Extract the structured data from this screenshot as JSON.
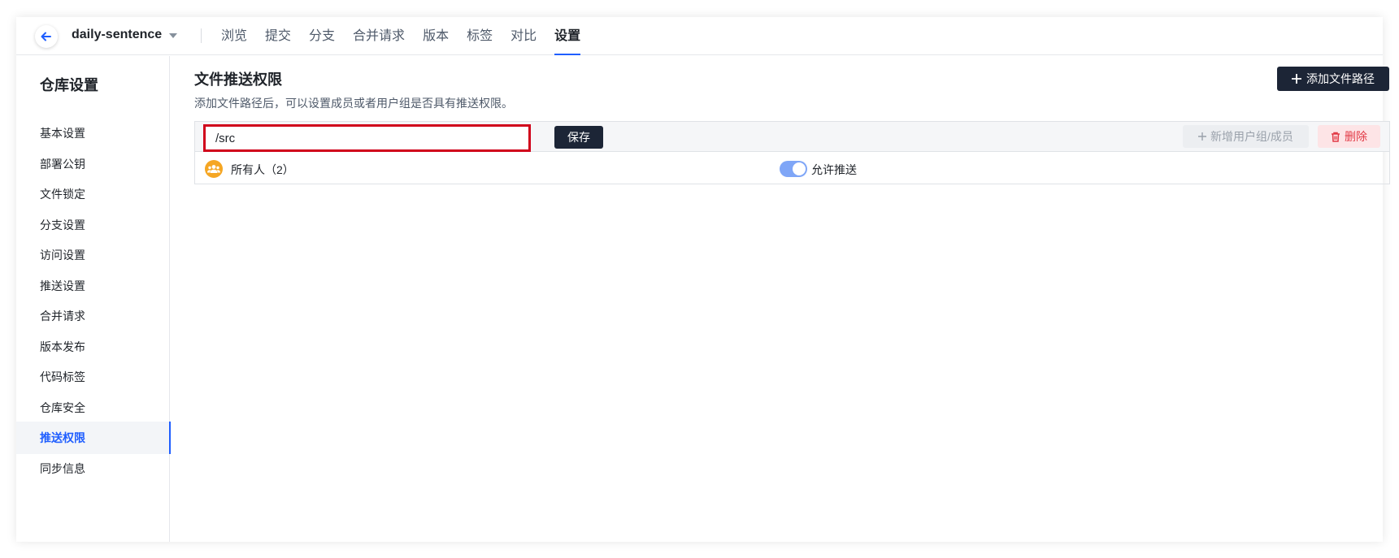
{
  "header": {
    "repo_name": "daily-sentence",
    "tabs": [
      {
        "label": "浏览"
      },
      {
        "label": "提交"
      },
      {
        "label": "分支"
      },
      {
        "label": "合并请求"
      },
      {
        "label": "版本"
      },
      {
        "label": "标签"
      },
      {
        "label": "对比"
      },
      {
        "label": "设置",
        "active": true
      }
    ]
  },
  "sidebar": {
    "title": "仓库设置",
    "items": [
      {
        "label": "基本设置"
      },
      {
        "label": "部署公钥"
      },
      {
        "label": "文件锁定"
      },
      {
        "label": "分支设置"
      },
      {
        "label": "访问设置"
      },
      {
        "label": "推送设置"
      },
      {
        "label": "合并请求"
      },
      {
        "label": "版本发布"
      },
      {
        "label": "代码标签"
      },
      {
        "label": "仓库安全"
      },
      {
        "label": "推送权限",
        "active": true
      },
      {
        "label": "同步信息"
      }
    ]
  },
  "main": {
    "title": "文件推送权限",
    "description": "添加文件路径后，可以设置成员或者用户组是否具有推送权限。",
    "add_path_label": "添加文件路径",
    "rule": {
      "path_value": "/src",
      "save_label": "保存",
      "add_member_label": "新增用户组/成员",
      "delete_label": "删除",
      "group_name": "所有人（2）",
      "allow_push_label": "允许推送",
      "allow_push_on": true
    }
  },
  "colors": {
    "accent": "#1f5eff",
    "dark_button": "#1c2536",
    "highlight_border": "#d0021b",
    "danger": "#e23a46",
    "avatar": "#f5a623"
  }
}
